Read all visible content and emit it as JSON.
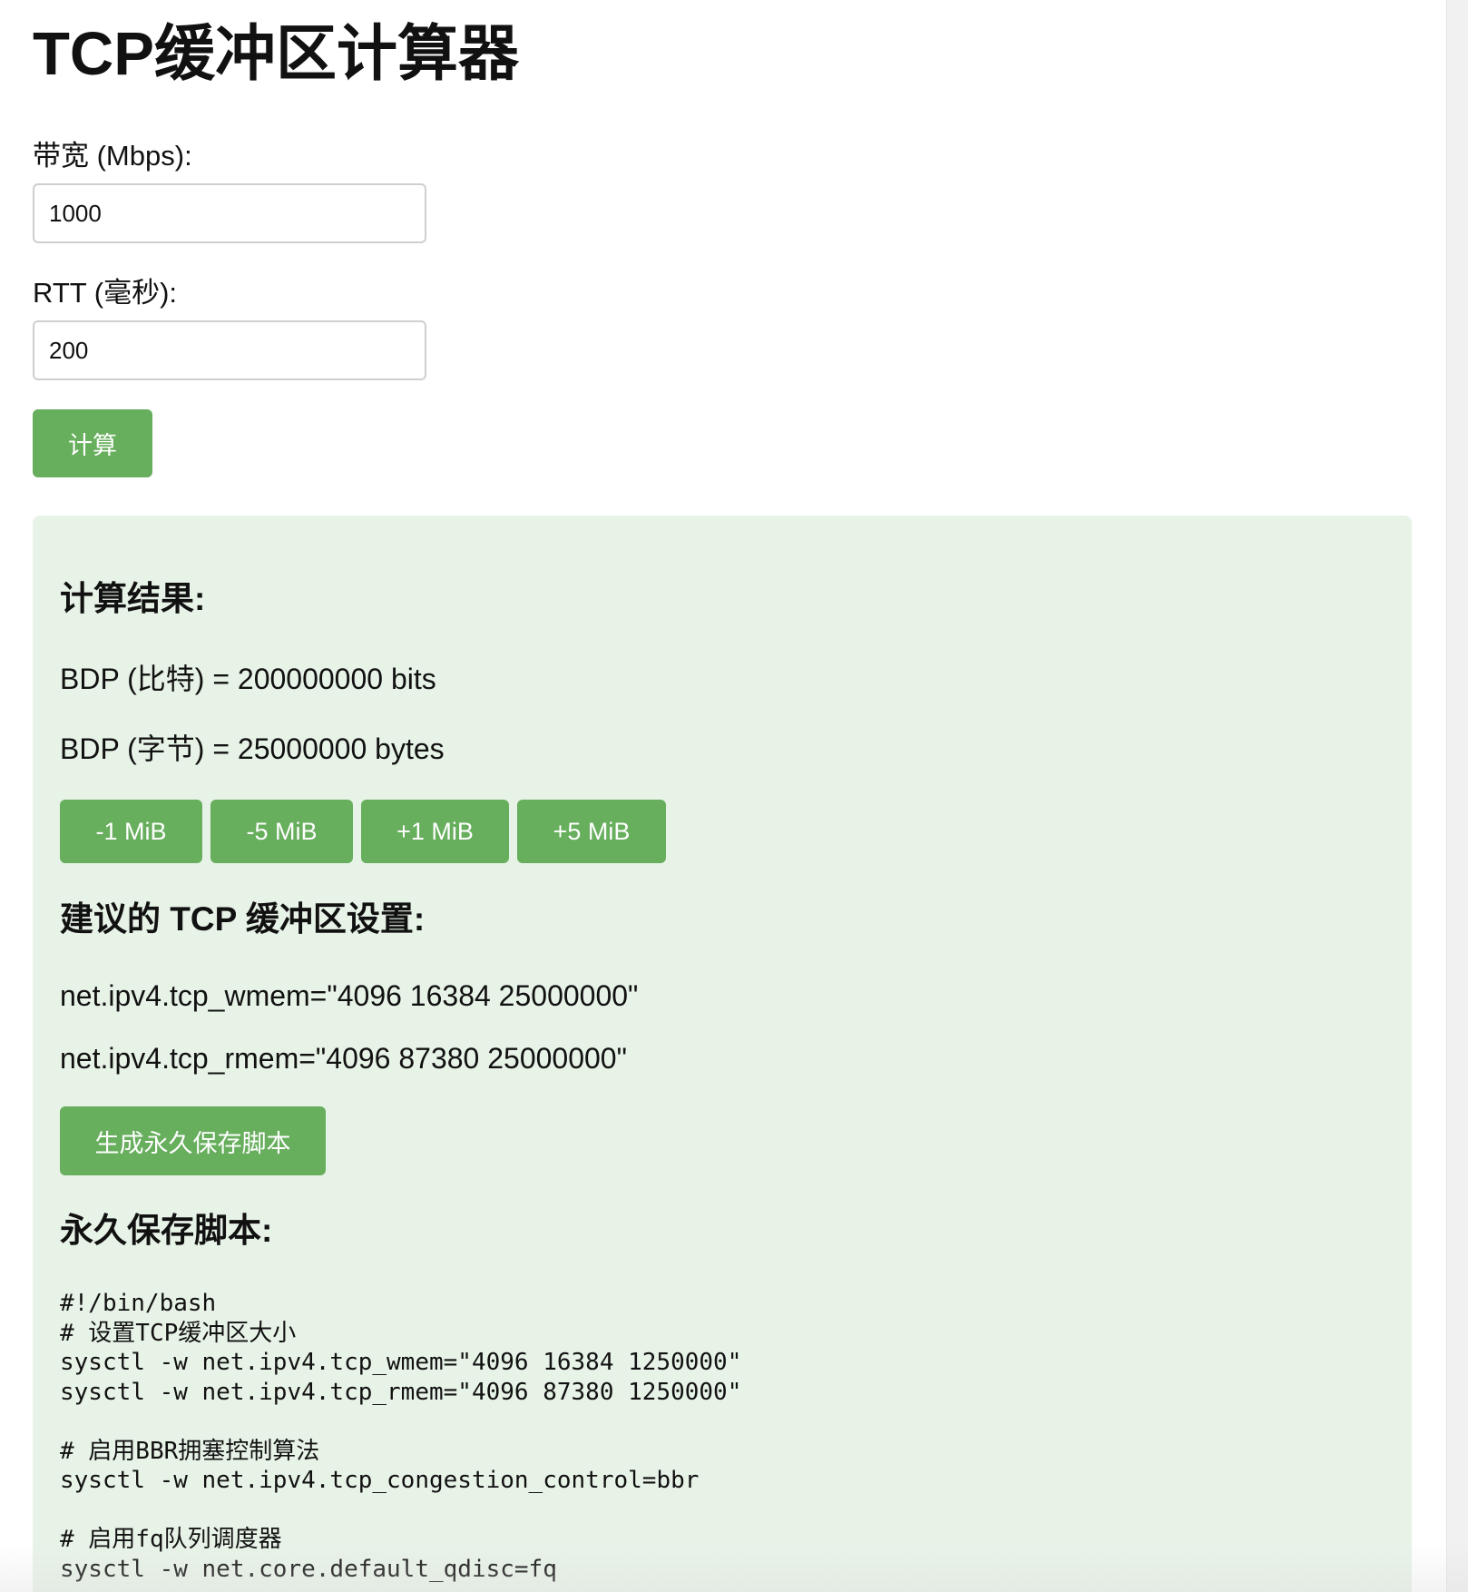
{
  "page": {
    "title": "TCP缓冲区计算器"
  },
  "form": {
    "bandwidth_label": "带宽 (Mbps):",
    "bandwidth_value": "1000",
    "rtt_label": "RTT (毫秒):",
    "rtt_value": "200",
    "calculate_label": "计算"
  },
  "results": {
    "heading": "计算结果:",
    "bdp_bits": "BDP (比特) = 200000000 bits",
    "bdp_bytes": "BDP (字节) = 25000000 bytes",
    "adjust_buttons": [
      "-1 MiB",
      "-5 MiB",
      "+1 MiB",
      "+5 MiB"
    ]
  },
  "recommended": {
    "heading": "建议的 TCP 缓冲区设置:",
    "wmem": "net.ipv4.tcp_wmem=\"4096 16384 25000000\"",
    "rmem": "net.ipv4.tcp_rmem=\"4096 87380 25000000\"",
    "generate_label": "生成永久保存脚本"
  },
  "script": {
    "heading": "永久保存脚本:",
    "content": "#!/bin/bash\n# 设置TCP缓冲区大小\nsysctl -w net.ipv4.tcp_wmem=\"4096 16384 1250000\"\nsysctl -w net.ipv4.tcp_rmem=\"4096 87380 1250000\"\n\n# 启用BBR拥塞控制算法\nsysctl -w net.ipv4.tcp_congestion_control=bbr\n\n# 启用fq队列调度器\nsysctl -w net.core.default_qdisc=fq"
  },
  "colors": {
    "accent": "#67ae5d",
    "panel_background": "#e8f3e8"
  }
}
